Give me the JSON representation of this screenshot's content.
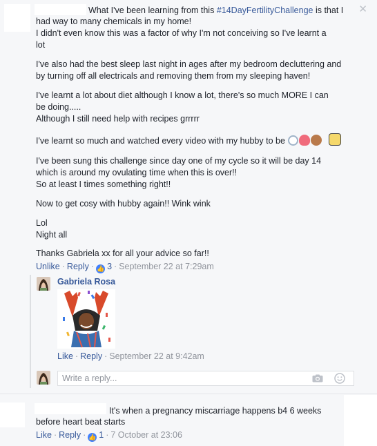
{
  "comment1": {
    "lines": [
      "What I've been learning from this ",
      "had way to many chemicals in my home!",
      "I didn't even know this was a factor of why I'm not conceiving so I've learnt a",
      "lot",
      "I've also had the best sleep last night in ages after my bedroom decluttering and",
      "by turning off all electricals and removing them from my sleeping haven!",
      "I've learnt a lot about diet although I know a lot, there's so much MORE I can",
      "be doing.....",
      "Although I still need help with recipes grrrrr",
      "I've learnt so much and watched every video with my hubby to be",
      "I've been sung this challenge since day one of my cycle so it will be day 14",
      "which is around my ovulating time when this is over!!",
      "So at least I times something right!!",
      "Now to get cosy with hubby again!! Wink wink",
      "Lol",
      "Night all",
      "Thanks Gabriela xx for all your advice so far!!"
    ],
    "hashtag": "#14DayFertilityChallenge",
    "after_hashtag": " is that I",
    "actions": {
      "unlike": "Unlike",
      "reply": "Reply",
      "like_count": "3",
      "timestamp": "September 22 at 7:29am"
    }
  },
  "reply": {
    "author": "Gabriela Rosa",
    "actions": {
      "like": "Like",
      "reply": "Reply",
      "timestamp": "September 22 at 9:42am"
    }
  },
  "reply_input": {
    "placeholder": "Write a reply..."
  },
  "comment2": {
    "line1": "It's when a pregnancy miscarriage happens b4 6 weeks",
    "line2": "before heart beat starts",
    "actions": {
      "like": "Like",
      "reply": "Reply",
      "like_count": "1",
      "timestamp": "7 October at 23:06"
    }
  },
  "icons": {
    "close": "close-icon",
    "camera": "camera-icon",
    "emoji": "emoji-icon",
    "like": "thumbs-up-icon"
  },
  "colors": {
    "link": "#365899",
    "muted": "#90949c",
    "like_badge": "#4080ff"
  }
}
